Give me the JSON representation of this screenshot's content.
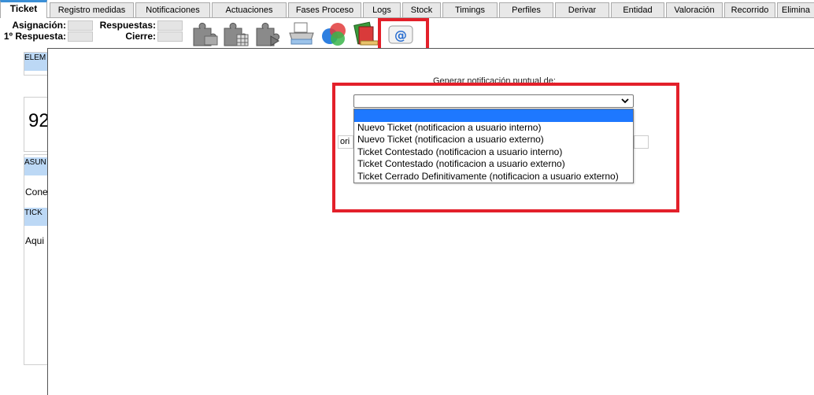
{
  "tabs": [
    "Ticket",
    "Registro medidas",
    "Notificaciones",
    "Actuaciones",
    "Fases Proceso",
    "Logs",
    "Stock",
    "Timings",
    "Perfiles",
    "Derivar",
    "Entidad",
    "Valoración",
    "Recorrido",
    "Elimina"
  ],
  "header": {
    "asignacion_label": "Asignación:",
    "respuestas_label": "Respuestas:",
    "primera_respuesta_label": "1º Respuesta:",
    "cierre_label": "Cierre:"
  },
  "left": {
    "head1": "ELEM",
    "number": "92",
    "head2": "ASUN",
    "text1": "Cone",
    "head3": "TICK",
    "text2": "Aqui"
  },
  "modal": {
    "label": "Generar notificación puntual de:",
    "select_value": "",
    "behind_input_text": "ori",
    "options": [
      "",
      "Nuevo Ticket (notificacion a usuario interno)",
      "Nuevo Ticket (notificacion a usuario externo)",
      "Ticket Contestado (notificacion a usuario interno)",
      "Ticket Contestado (notificacion a usuario externo)",
      "Ticket Cerrado Definitivamente (notificacion a usuario externo)"
    ]
  },
  "icons": [
    "puzzle-icon",
    "puzzle-table-icon",
    "puzzle-export-icon",
    "print-icon",
    "color-circles-icon",
    "book-stack-icon",
    "email-at-icon"
  ],
  "colors": {
    "highlight_red": "#e3202a",
    "selected_option": "#1e78ff",
    "tab_accent": "#3b8fd6"
  }
}
